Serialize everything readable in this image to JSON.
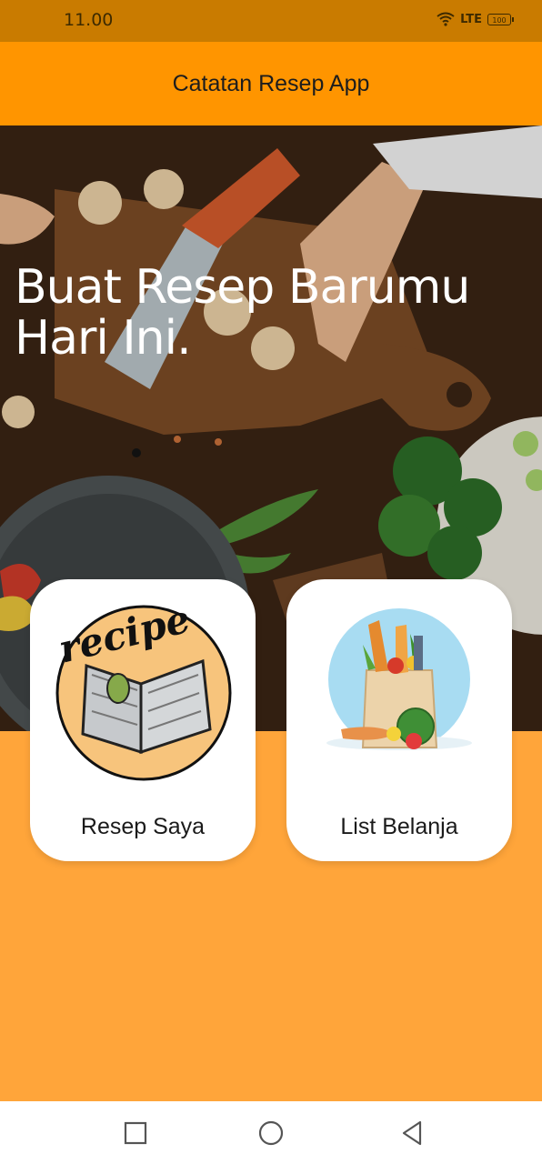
{
  "status_bar": {
    "time": "11.00",
    "network": "LTE",
    "battery": "100",
    "icons": [
      "wifi-icon",
      "signal-icon",
      "battery-icon"
    ]
  },
  "app_bar": {
    "title": "Catatan Resep App"
  },
  "hero": {
    "headline": "Buat Resep Barumu Hari Ini."
  },
  "cards": [
    {
      "label": "Resep Saya",
      "icon": "recipe-book-icon",
      "icon_text": "recipe"
    },
    {
      "label": "List Belanja",
      "icon": "grocery-bag-icon"
    }
  ],
  "nav_bar": {
    "icons": [
      "recent-apps-icon",
      "home-icon",
      "back-icon"
    ]
  },
  "colors": {
    "status_bar": "#C97B00",
    "app_bar": "#FF9500",
    "background": "#FFA53A",
    "card": "#FFFFFF"
  }
}
